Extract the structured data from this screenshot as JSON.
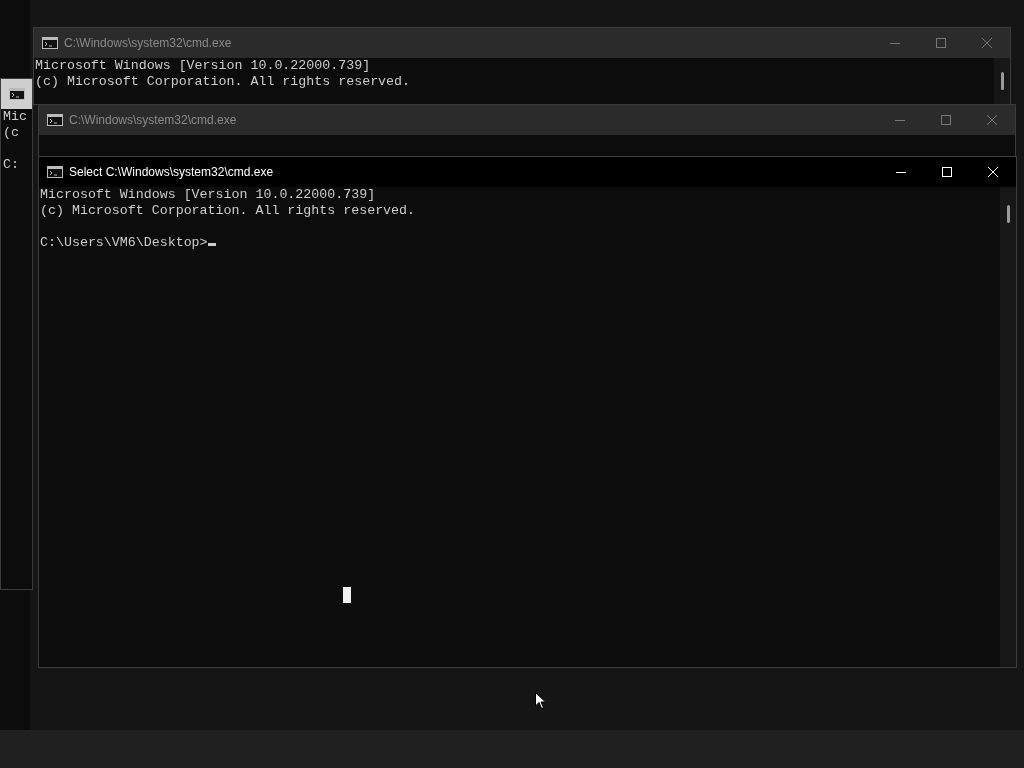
{
  "windows": [
    {
      "active": false,
      "lines": [
        {
          "text": "Mic",
          "spaced": false
        },
        {
          "text": "(c",
          "spaced": false
        },
        {
          "text": "C:",
          "spaced": true
        }
      ]
    },
    {
      "title": "C:\\Windows\\system32\\cmd.exe",
      "active": false,
      "lines": [
        {
          "text": "Microsoft Windows [Version 10.0.22000.739]",
          "spaced": false
        },
        {
          "text": "(c) Microsoft Corporation. All rights reserved.",
          "spaced": false
        }
      ]
    },
    {
      "title": "C:\\Windows\\system32\\cmd.exe",
      "active": false
    },
    {
      "title": "Select C:\\Windows\\system32\\cmd.exe",
      "active": true,
      "lines": [
        {
          "text": "Microsoft Windows [Version 10.0.22000.739]",
          "spaced": false
        },
        {
          "text": "(c) Microsoft Corporation. All rights reserved.",
          "spaced": false
        },
        {
          "text": "C:\\Users\\VM6\\Desktop>",
          "spaced": true
        }
      ]
    }
  ]
}
